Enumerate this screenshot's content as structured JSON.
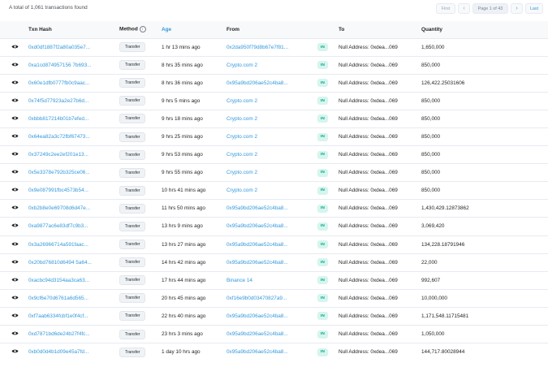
{
  "summary": "A total of 1,061 transactions found",
  "pagination": {
    "first": "First",
    "prev": "‹",
    "page": "Page 1 of 43",
    "next": "›",
    "last": "Last"
  },
  "columns": {
    "hash": "Txn Hash",
    "method": "Method",
    "age": "Age",
    "from": "From",
    "to": "To",
    "quantity": "Quantity"
  },
  "direction_label": "IN",
  "method_label": "Transfer",
  "to_label": "Null Address: 0xdea...069",
  "rows": [
    {
      "hash": "0xd0df1887f2a80a035e7...",
      "age": "1 hr 13 mins ago",
      "from": "0x2da950f79d8b67e7f81...",
      "qty": "1,650,000"
    },
    {
      "hash": "0xa1cd874957156 7b693...",
      "age": "8 hrs 35 mins ago",
      "from": "Crypto.com 2",
      "qty": "850,000"
    },
    {
      "hash": "0x60e1dfb0777fb0c9aac...",
      "age": "8 hrs 36 mins ago",
      "from": "0x95a9bd206ae52c4ba8...",
      "qty": "126,422.25031606"
    },
    {
      "hash": "0x74f5d77923a2e27b6d...",
      "age": "9 hrs 5 mins ago",
      "from": "Crypto.com 2",
      "qty": "850,000"
    },
    {
      "hash": "0xbbb817214b01b7efed...",
      "age": "9 hrs 18 mins ago",
      "from": "Crypto.com 2",
      "qty": "850,000"
    },
    {
      "hash": "0x64ea82a3c72fbf67473...",
      "age": "9 hrs 25 mins ago",
      "from": "Crypto.com 2",
      "qty": "850,000"
    },
    {
      "hash": "0x37249c2ee2ef201e13...",
      "age": "9 hrs 53 mins ago",
      "from": "Crypto.com 2",
      "qty": "850,000"
    },
    {
      "hash": "0x5e3378e792b325ce06...",
      "age": "9 hrs 55 mins ago",
      "from": "Crypto.com 2",
      "qty": "850,000"
    },
    {
      "hash": "0x9e087991fbc4573b54...",
      "age": "10 hrs 41 mins ago",
      "from": "Crypto.com 2",
      "qty": "850,000"
    },
    {
      "hash": "0xb2b8e0e69708d6d47e...",
      "age": "11 hrs 50 mins ago",
      "from": "0x95a9bd206ae52c4ba8...",
      "qty": "1,430,429.12873862"
    },
    {
      "hash": "0xa9877ac6e83df7c9b3...",
      "age": "13 hrs 9 mins ago",
      "from": "0x95a9bd206ae52c4ba8...",
      "qty": "3,069,420"
    },
    {
      "hash": "0x3a26966714a591faac...",
      "age": "13 hrs 27 mins ago",
      "from": "0x95a9bd206ae52c4ba8...",
      "qty": "134,228.18791946"
    },
    {
      "hash": "0x20bd76810d6494 5a64...",
      "age": "14 hrs 42 mins ago",
      "from": "0x95a9bd206ae52c4ba8...",
      "qty": "22,000"
    },
    {
      "hash": "0xacbc94d3154aa3ca63...",
      "age": "17 hrs 44 mins ago",
      "from": "Binance 14",
      "qty": "992,607"
    },
    {
      "hash": "0x9cf6e70d6761a6d565...",
      "age": "20 hrs 45 mins ago",
      "from": "0xf16e9b0d03470827a9...",
      "qty": "10,000,000"
    },
    {
      "hash": "0xf7aab6334fcbf1e0f4cf...",
      "age": "22 hrs 40 mins ago",
      "from": "0x95a9bd206ae52c4ba8...",
      "qty": "1,171,548.11715481"
    },
    {
      "hash": "0xd7871bd6de24b27f4fc...",
      "age": "23 hrs 3 mins ago",
      "from": "0x95a9bd206ae52c4ba8...",
      "qty": "1,050,000"
    },
    {
      "hash": "0xb0d0d4b1d09e45a7fd...",
      "age": "1 day 10 hrs ago",
      "from": "0x95a9bd206ae52c4ba8...",
      "qty": "144,717.80028944"
    }
  ]
}
